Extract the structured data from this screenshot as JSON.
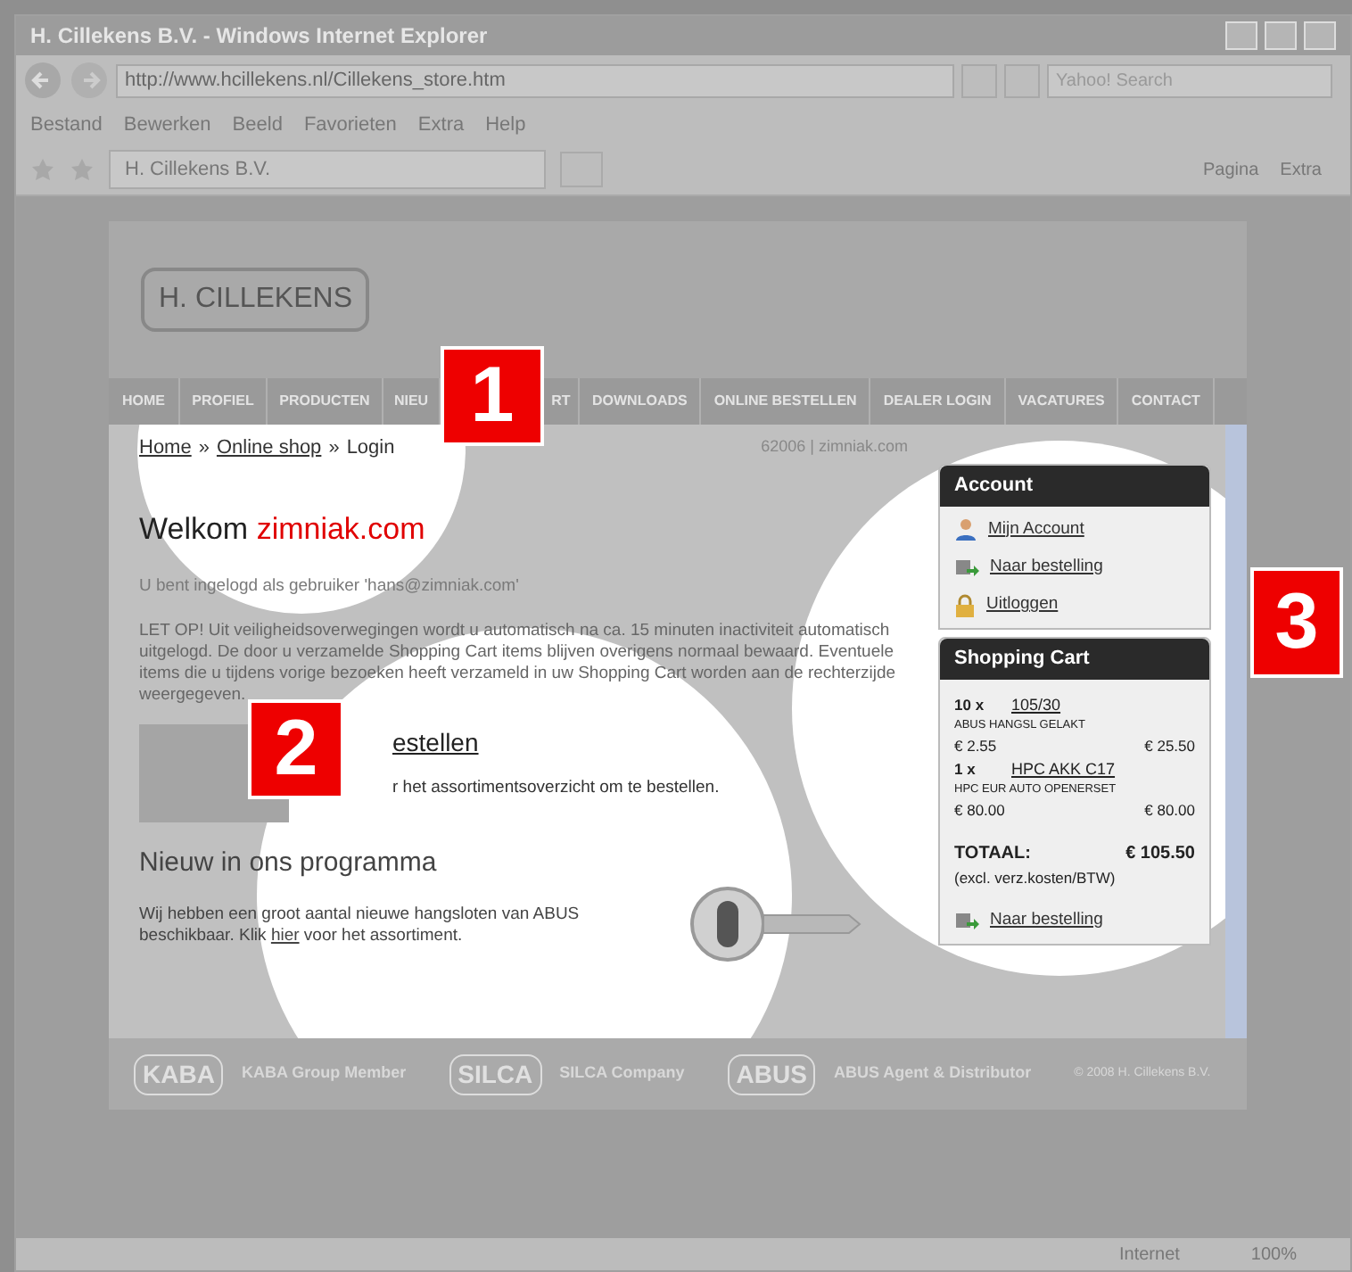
{
  "window": {
    "title": "H. Cillekens B.V. - Windows Internet Explorer"
  },
  "address_bar": {
    "url": "http://www.hcillekens.nl/Cillekens_store.htm",
    "search_placeholder": "Yahoo! Search"
  },
  "menu": [
    "Bestand",
    "Bewerken",
    "Beeld",
    "Favorieten",
    "Extra",
    "Help"
  ],
  "tab": {
    "title": "H. Cillekens B.V."
  },
  "command_bar": [
    "Pagina",
    "Extra"
  ],
  "site": {
    "logo": "H. CILLEKENS",
    "nav": [
      "HOME",
      "PROFIEL",
      "PRODUCTEN",
      "NIEU",
      "RT",
      "DOWNLOADS",
      "ONLINE BESTELLEN",
      "DEALER LOGIN",
      "VACATURES",
      "CONTACT"
    ],
    "breadcrumb": [
      "Home",
      "Online shop",
      "Login"
    ],
    "breadcrumb_separator": "»",
    "session": "62006 | zimniak.com",
    "welcome": {
      "greeting": "Welkom",
      "name": "zimniak.com"
    },
    "login_note": "U bent ingelogd als gebruiker 'hans@zimniak.com'",
    "notice": "LET OP! Uit veiligheidsoverwegingen wordt u automatisch na ca. 15 minuten inactiviteit automatisch uitgelogd. De door u verzamelde Shopping Cart items blijven overigens normaal bewaard. Eventuele items die u tijdens vorige bezoeken heeft verzameld in uw Shopping Cart worden aan de rechterzijde weergegeven.",
    "order_block": {
      "heading": "estellen",
      "text": "r het assortimentsoverzicht om te bestellen."
    },
    "news": {
      "heading": "Nieuw in ons programma",
      "text_before": "Wij hebben een groot aantal nieuwe hangsloten van ABUS beschikbaar. Klik",
      "link": "hier",
      "text_after": "voor het assortiment."
    },
    "account": {
      "title": "Account",
      "links": [
        {
          "kind": "user",
          "label": "Mijn Account"
        },
        {
          "kind": "order",
          "label": "Naar bestelling"
        },
        {
          "kind": "lock",
          "label": "Uitloggen"
        }
      ]
    },
    "cart": {
      "title": "Shopping Cart",
      "items": [
        {
          "quantity": "10 x",
          "code": "105/30",
          "description": "ABUS HANGSL GELAKT",
          "unit_price": "€ 2.55",
          "line_total": "€ 25.50"
        },
        {
          "quantity": "1 x",
          "code": "HPC AKK C17",
          "description": "HPC EUR AUTO OPENERSET",
          "unit_price": "€ 80.00",
          "line_total": "€ 80.00"
        }
      ],
      "total_label": "TOTAAL:",
      "total": "€ 105.50",
      "note": "(excl. verz.kosten/BTW)",
      "link": "Naar bestelling"
    },
    "footer": [
      {
        "logo": "KABA",
        "caption": "KABA Group Member"
      },
      {
        "logo": "SILCA",
        "caption": "SILCA Company"
      },
      {
        "logo": "ABUS",
        "caption": "ABUS Agent & Distributor"
      }
    ],
    "copyright": "© 2008 H. Cillekens B.V."
  },
  "callouts": [
    "1",
    "2",
    "3"
  ],
  "status_bar": {
    "zone": "Internet",
    "zoom": "100%"
  }
}
